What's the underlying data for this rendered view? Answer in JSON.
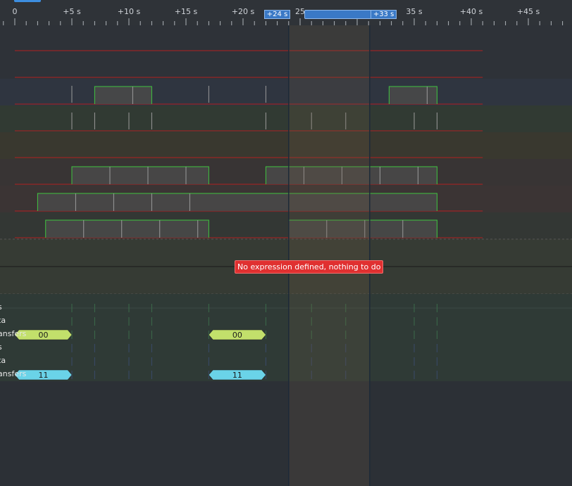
{
  "ruler": {
    "ticks": [
      {
        "label": "0",
        "t": 0
      },
      {
        "label": "+5 s",
        "t": 5
      },
      {
        "label": "+10 s",
        "t": 10
      },
      {
        "label": "+15 s",
        "t": 15
      },
      {
        "label": "+20 s",
        "t": 20
      },
      {
        "label": "25",
        "t": 25
      },
      {
        "label": "35 s",
        "t": 35
      },
      {
        "label": "+40 s",
        "t": 40
      },
      {
        "label": "+45 s",
        "t": 45
      }
    ],
    "marker_a": "+24 s",
    "marker_b": "+33 s",
    "marker_a_t": 24.0,
    "marker_b_t": 31.1
  },
  "colors": {
    "signal_high": "#3fc43f",
    "signal_low": "#b02020",
    "annotation_a": "#c2e06b",
    "annotation_b": "#6ad3e8",
    "error": "#e03030",
    "selection": "#4b4340"
  },
  "analog_rows": [
    {
      "segments": []
    },
    {
      "segments": []
    },
    {
      "segments": [
        [
          7.0,
          12.0
        ]
      ],
      "ticks": [
        5.0,
        17.0,
        22.0
      ],
      "second": [
        [
          32.8,
          37.0
        ]
      ]
    },
    {
      "segments": [],
      "ticks": [
        5.0,
        7.0,
        10.0,
        12.0,
        22.0,
        26.0,
        29.0,
        35.0,
        37.0
      ]
    },
    {
      "segments": []
    },
    {
      "segments": [
        [
          5.0,
          17.0
        ]
      ],
      "second": [
        [
          22.0,
          37.0
        ]
      ]
    },
    {
      "segments": [
        [
          2.0,
          37.0
        ]
      ]
    },
    {
      "segments": [
        [
          2.7,
          17.0
        ]
      ],
      "second": [
        [
          24.0,
          37.0
        ]
      ]
    }
  ],
  "error_message": "No expression defined, nothing to do",
  "decoder_rows": [
    {
      "label": "s"
    },
    {
      "label": "ta"
    },
    {
      "label": "ansfers",
      "annotations": [
        {
          "text": "00",
          "start": 0,
          "end": 5.0,
          "color": "annotation_a"
        },
        {
          "text": "00",
          "start": 17.0,
          "end": 22.0,
          "color": "annotation_a"
        }
      ]
    },
    {
      "label": "s"
    },
    {
      "label": "ta"
    },
    {
      "label": "ansfers",
      "annotations": [
        {
          "text": "11",
          "start": 0,
          "end": 5.0,
          "color": "annotation_b"
        },
        {
          "text": "11",
          "start": 17.0,
          "end": 22.0,
          "color": "annotation_b"
        }
      ]
    }
  ]
}
